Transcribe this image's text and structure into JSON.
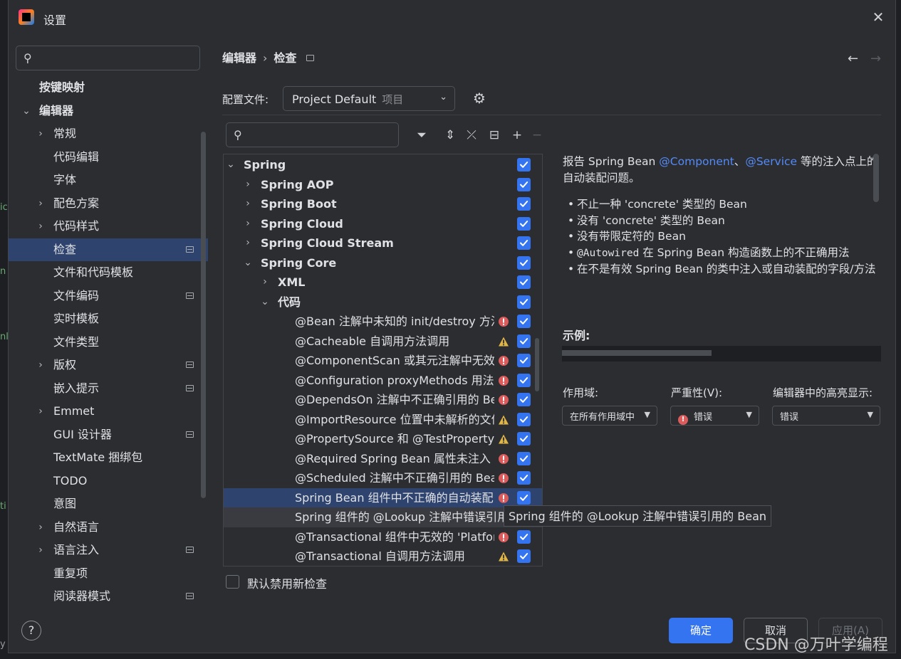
{
  "window": {
    "title": "设置"
  },
  "search": {
    "placeholder": ""
  },
  "sidebar": {
    "items": [
      {
        "label": "按键映射",
        "level": 0,
        "arrow": "",
        "proj": false,
        "selected": false
      },
      {
        "label": "编辑器",
        "level": 0,
        "arrow": "expanded",
        "proj": false,
        "selected": false
      },
      {
        "label": "常规",
        "level": 1,
        "arrow": "collapsed",
        "proj": false,
        "selected": false
      },
      {
        "label": "代码编辑",
        "level": 1,
        "arrow": "",
        "proj": false,
        "selected": false
      },
      {
        "label": "字体",
        "level": 1,
        "arrow": "",
        "proj": false,
        "selected": false
      },
      {
        "label": "配色方案",
        "level": 1,
        "arrow": "collapsed",
        "proj": false,
        "selected": false
      },
      {
        "label": "代码样式",
        "level": 1,
        "arrow": "collapsed",
        "proj": false,
        "selected": false
      },
      {
        "label": "检查",
        "level": 1,
        "arrow": "",
        "proj": true,
        "selected": true
      },
      {
        "label": "文件和代码模板",
        "level": 1,
        "arrow": "",
        "proj": false,
        "selected": false
      },
      {
        "label": "文件编码",
        "level": 1,
        "arrow": "",
        "proj": true,
        "selected": false
      },
      {
        "label": "实时模板",
        "level": 1,
        "arrow": "",
        "proj": false,
        "selected": false
      },
      {
        "label": "文件类型",
        "level": 1,
        "arrow": "",
        "proj": false,
        "selected": false
      },
      {
        "label": "版权",
        "level": 1,
        "arrow": "collapsed",
        "proj": true,
        "selected": false
      },
      {
        "label": "嵌入提示",
        "level": 1,
        "arrow": "",
        "proj": true,
        "selected": false
      },
      {
        "label": "Emmet",
        "level": 1,
        "arrow": "collapsed",
        "proj": false,
        "selected": false
      },
      {
        "label": "GUI 设计器",
        "level": 1,
        "arrow": "",
        "proj": true,
        "selected": false
      },
      {
        "label": "TextMate 捆绑包",
        "level": 1,
        "arrow": "",
        "proj": false,
        "selected": false
      },
      {
        "label": "TODO",
        "level": 1,
        "arrow": "",
        "proj": false,
        "selected": false
      },
      {
        "label": "意图",
        "level": 1,
        "arrow": "",
        "proj": false,
        "selected": false
      },
      {
        "label": "自然语言",
        "level": 1,
        "arrow": "collapsed",
        "proj": false,
        "selected": false
      },
      {
        "label": "语言注入",
        "level": 1,
        "arrow": "collapsed",
        "proj": true,
        "selected": false
      },
      {
        "label": "重复项",
        "level": 1,
        "arrow": "",
        "proj": false,
        "selected": false
      },
      {
        "label": "阅读器模式",
        "level": 1,
        "arrow": "",
        "proj": true,
        "selected": false
      }
    ]
  },
  "breadcrumb": {
    "parent": "编辑器",
    "separator": "›",
    "current": "检查"
  },
  "profile": {
    "label": "配置文件:",
    "value": "Project Default",
    "hint": "项目"
  },
  "tree": {
    "rows": [
      {
        "label": "Spring",
        "level": 0,
        "arrow": "expanded",
        "bold": true,
        "severity": "",
        "checked": true,
        "state": ""
      },
      {
        "label": "Spring AOP",
        "level": 1,
        "arrow": "collapsed",
        "bold": true,
        "severity": "",
        "checked": true,
        "state": ""
      },
      {
        "label": "Spring Boot",
        "level": 1,
        "arrow": "collapsed",
        "bold": true,
        "severity": "",
        "checked": true,
        "state": ""
      },
      {
        "label": "Spring Cloud",
        "level": 1,
        "arrow": "collapsed",
        "bold": true,
        "severity": "",
        "checked": true,
        "state": ""
      },
      {
        "label": "Spring Cloud Stream",
        "level": 1,
        "arrow": "collapsed",
        "bold": true,
        "severity": "",
        "checked": true,
        "state": ""
      },
      {
        "label": "Spring Core",
        "level": 1,
        "arrow": "expanded",
        "bold": true,
        "severity": "",
        "checked": true,
        "state": ""
      },
      {
        "label": "XML",
        "level": 2,
        "arrow": "collapsed",
        "bold": true,
        "severity": "",
        "checked": true,
        "state": ""
      },
      {
        "label": "代码",
        "level": 2,
        "arrow": "expanded",
        "bold": true,
        "severity": "",
        "checked": true,
        "state": ""
      },
      {
        "label": "@Bean 注解中未知的 init/destroy 方法",
        "level": 3,
        "arrow": "",
        "bold": false,
        "severity": "error",
        "checked": true,
        "state": ""
      },
      {
        "label": "@Cacheable 自调用方法调用",
        "level": 3,
        "arrow": "",
        "bold": false,
        "severity": "warning",
        "checked": true,
        "state": ""
      },
      {
        "label": "@ComponentScan 或其元注解中无效的",
        "level": 3,
        "arrow": "",
        "bold": false,
        "severity": "error",
        "checked": true,
        "state": ""
      },
      {
        "label": "@Configuration proxyMethods 用法警告",
        "level": 3,
        "arrow": "",
        "bold": false,
        "severity": "error",
        "checked": true,
        "state": ""
      },
      {
        "label": "@DependsOn 注解中不正确引用的 Bean",
        "level": 3,
        "arrow": "",
        "bold": false,
        "severity": "error",
        "checked": true,
        "state": ""
      },
      {
        "label": "@ImportResource 位置中未解析的文件",
        "level": 3,
        "arrow": "",
        "bold": false,
        "severity": "warning",
        "checked": true,
        "state": ""
      },
      {
        "label": "@PropertySource 和 @TestPropertySource",
        "level": 3,
        "arrow": "",
        "bold": false,
        "severity": "warning",
        "checked": true,
        "state": ""
      },
      {
        "label": "@Required Spring Bean 属性未注入",
        "level": 3,
        "arrow": "",
        "bold": false,
        "severity": "error",
        "checked": true,
        "state": ""
      },
      {
        "label": "@Scheduled 注解中不正确引用的 Bean",
        "level": 3,
        "arrow": "",
        "bold": false,
        "severity": "error",
        "checked": true,
        "state": ""
      },
      {
        "label": "Spring Bean 组件中不正确的自动装配",
        "level": 3,
        "arrow": "",
        "bold": false,
        "severity": "error",
        "checked": true,
        "state": "selected"
      },
      {
        "label": "Spring 组件的 @Lookup 注解中错误引用的 Bean",
        "level": 3,
        "arrow": "",
        "bold": false,
        "severity": "",
        "checked": false,
        "state": "hover"
      },
      {
        "label": "@Transactional 组件中无效的 'Platform",
        "level": 3,
        "arrow": "",
        "bold": false,
        "severity": "error",
        "checked": true,
        "state": ""
      },
      {
        "label": "@Transactional 自调用方法调用",
        "level": 3,
        "arrow": "",
        "bold": false,
        "severity": "warning",
        "checked": true,
        "state": ""
      }
    ],
    "tooltip": "Spring 组件的 @Lookup 注解中错误引用的 Bean"
  },
  "default_disable": {
    "label": "默认禁用新检查",
    "checked": false
  },
  "description": {
    "intro_before": "报告 Spring Bean ",
    "component": "@Component",
    "sep": "、",
    "service": "@Service",
    "intro_after": " 等的注入点上的自动装配问题。",
    "bullets": [
      "不止一种 'concrete' 类型的 Bean",
      "没有 'concrete' 类型的 Bean",
      "没有带限定符的 Bean",
      "在不是有效 Spring Bean 的类中注入或自动装配的字段/方法"
    ],
    "autowired_code": "@Autowired",
    "autowired_text": " 在 Spring Bean 构造函数上的不正确用法",
    "example_title": "示例:"
  },
  "options": {
    "scope_label": "作用域:",
    "scope_value": "在所有作用域中",
    "severity_label": "严重性(V):",
    "severity_value": "错误",
    "highlight_label": "编辑器中的高亮显示:",
    "highlight_value": "错误"
  },
  "footer": {
    "help": "?",
    "ok": "确定",
    "cancel": "取消",
    "apply": "应用(A)"
  },
  "watermark": "CSDN @万叶学编程",
  "colors": {
    "accent": "#3574f0",
    "selection": "#2e436e",
    "error": "#db5c5c",
    "warning": "#e0b548",
    "link": "#548af7"
  }
}
